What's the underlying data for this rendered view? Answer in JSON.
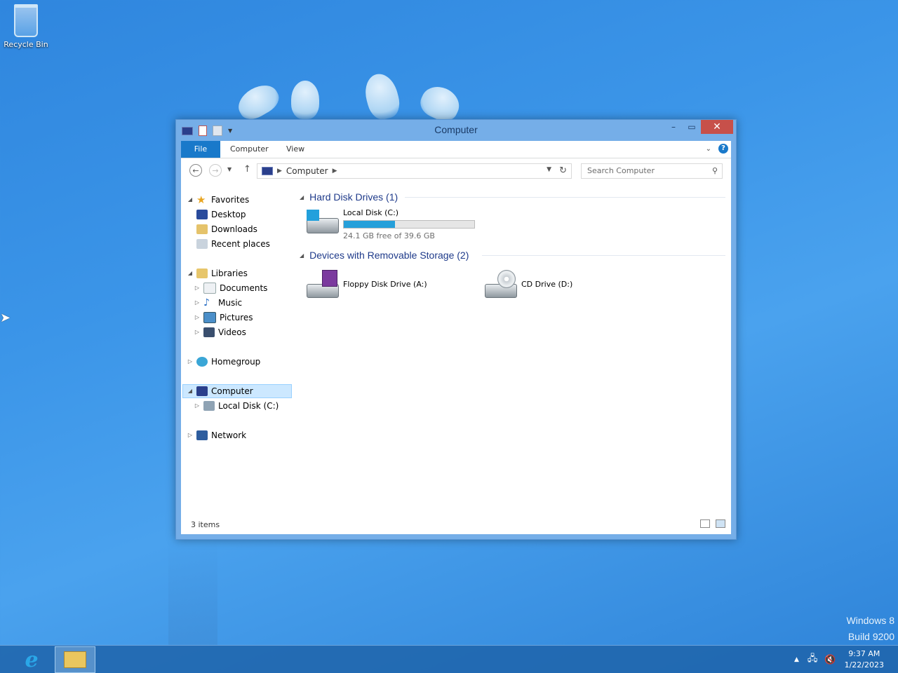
{
  "desktop": {
    "recycle_bin_label": "Recycle Bin",
    "watermark_line1": "Windows 8",
    "watermark_line2": "Build 9200"
  },
  "window": {
    "title": "Computer",
    "ribbon_tabs": [
      "File",
      "Computer",
      "View"
    ],
    "help_label": "?",
    "address_path": "Computer",
    "search_placeholder": "Search Computer",
    "accent_color": "#1979ca"
  },
  "navpane": {
    "favorites": "Favorites",
    "desktop": "Desktop",
    "downloads": "Downloads",
    "recent_places": "Recent places",
    "libraries": "Libraries",
    "documents": "Documents",
    "music": "Music",
    "pictures": "Pictures",
    "videos": "Videos",
    "homegroup": "Homegroup",
    "computer": "Computer",
    "local_disk": "Local Disk (C:)",
    "network": "Network"
  },
  "content": {
    "group_hdd": "Hard Disk Drives (1)",
    "group_removable": "Devices with Removable Storage (2)",
    "local_disk_name": "Local Disk (C:)",
    "local_disk_free": "24.1 GB free of 39.6 GB",
    "local_disk_used_fraction": 0.39,
    "floppy_name": "Floppy Disk Drive (A:)",
    "cd_name": "CD Drive (D:)"
  },
  "statusbar": {
    "item_count": "3 items"
  },
  "taskbar": {
    "time": "9:37 AM",
    "date": "1/22/2023"
  }
}
